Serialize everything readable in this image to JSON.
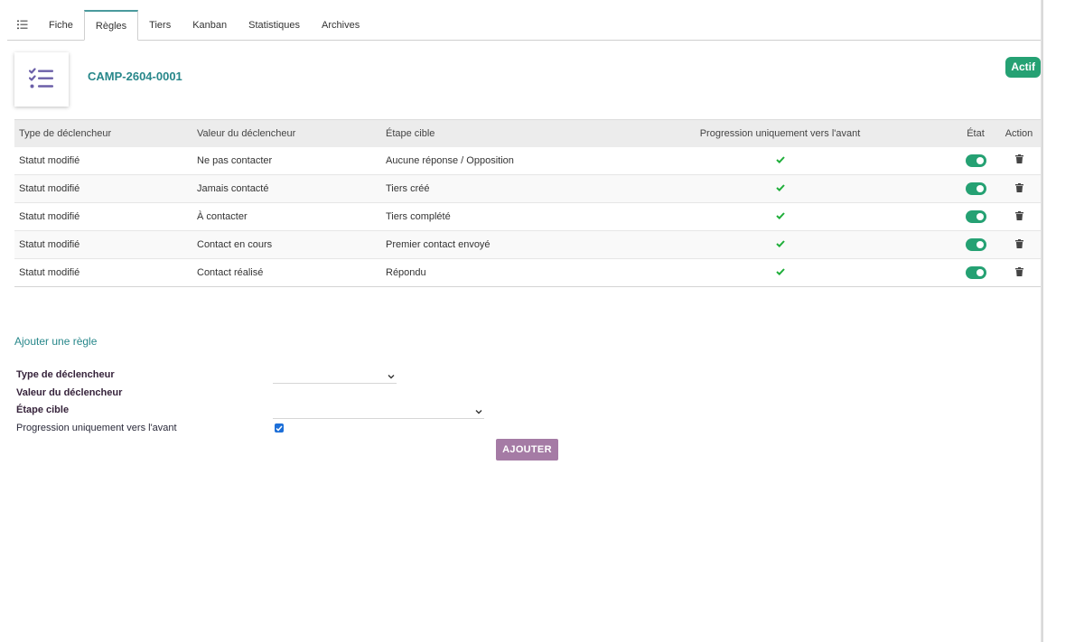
{
  "tabs": [
    {
      "label": "Fiche"
    },
    {
      "label": "Règles"
    },
    {
      "label": "Tiers"
    },
    {
      "label": "Kanban"
    },
    {
      "label": "Statistiques"
    },
    {
      "label": "Archives"
    }
  ],
  "active_tab": "Règles",
  "header": {
    "ref": "CAMP-2604-0001",
    "status": "Actif",
    "logo_icon": "list-check-icon"
  },
  "table": {
    "columns": {
      "type": "Type de déclencheur",
      "value": "Valeur du déclencheur",
      "target": "Étape cible",
      "forward": "Progression uniquement vers l'avant",
      "state": "État",
      "action": "Action"
    },
    "rows": [
      {
        "type": "Statut modifié",
        "value": "Ne pas contacter",
        "target": "Aucune réponse / Opposition",
        "forward": true,
        "enabled": true
      },
      {
        "type": "Statut modifié",
        "value": "Jamais contacté",
        "target": "Tiers créé",
        "forward": true,
        "enabled": true
      },
      {
        "type": "Statut modifié",
        "value": "À contacter",
        "target": "Tiers complété",
        "forward": true,
        "enabled": true
      },
      {
        "type": "Statut modifié",
        "value": "Contact en cours",
        "target": "Premier contact envoyé",
        "forward": true,
        "enabled": true
      },
      {
        "type": "Statut modifié",
        "value": "Contact réalisé",
        "target": "Répondu",
        "forward": true,
        "enabled": true
      }
    ]
  },
  "form": {
    "title": "Ajouter une règle",
    "type_label": "Type de déclencheur",
    "type_value": "",
    "value_label": "Valeur du déclencheur",
    "target_label": "Étape cible",
    "target_value": "",
    "forward_label": "Progression uniquement vers l'avant",
    "forward_checked": true,
    "submit_label": "AJOUTER"
  },
  "colors": {
    "accent": "#27878a",
    "status_green": "#25a173",
    "button_purple": "#a57ba5",
    "check_green": "#1fae3a"
  }
}
